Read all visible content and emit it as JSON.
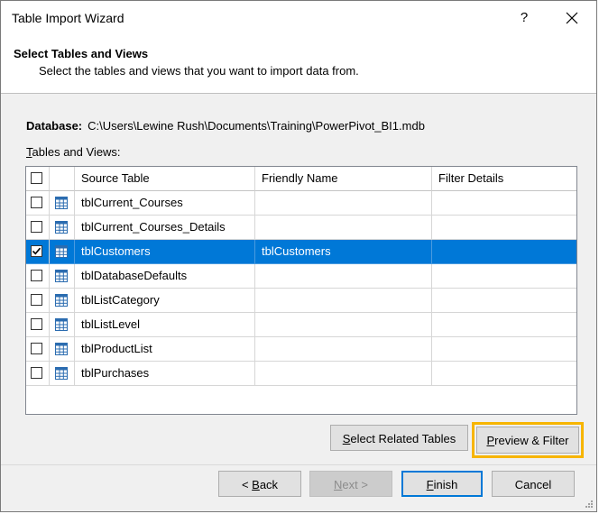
{
  "window": {
    "title": "Table Import Wizard",
    "help_label": "?",
    "header_title": "Select Tables and Views",
    "header_subtitle": "Select the tables and views that you want to import data from."
  },
  "database": {
    "label": "Database:",
    "path": "C:\\Users\\Lewine Rush\\Documents\\Training\\PowerPivot_BI1.mdb"
  },
  "tables_label": {
    "mnemonic": "T",
    "rest": "ables and Views:"
  },
  "grid": {
    "columns": [
      "Source Table",
      "Friendly Name",
      "Filter Details"
    ],
    "rows": [
      {
        "source": "tblCurrent_Courses",
        "friendly": "",
        "filter": "",
        "checked": false,
        "selected": false
      },
      {
        "source": "tblCurrent_Courses_Details",
        "friendly": "",
        "filter": "",
        "checked": false,
        "selected": false
      },
      {
        "source": "tblCustomers",
        "friendly": "tblCustomers",
        "filter": "",
        "checked": true,
        "selected": true
      },
      {
        "source": "tblDatabaseDefaults",
        "friendly": "",
        "filter": "",
        "checked": false,
        "selected": false
      },
      {
        "source": "tblListCategory",
        "friendly": "",
        "filter": "",
        "checked": false,
        "selected": false
      },
      {
        "source": "tblListLevel",
        "friendly": "",
        "filter": "",
        "checked": false,
        "selected": false
      },
      {
        "source": "tblProductList",
        "friendly": "",
        "filter": "",
        "checked": false,
        "selected": false
      },
      {
        "source": "tblPurchases",
        "friendly": "",
        "filter": "",
        "checked": false,
        "selected": false
      }
    ]
  },
  "buttons": {
    "select_related": {
      "mnemonic": "S",
      "rest": "elect Related Tables"
    },
    "preview_filter": {
      "mnemonic": "P",
      "rest": "review & Filter"
    },
    "back": {
      "prefix": "< ",
      "mnemonic": "B",
      "rest": "ack"
    },
    "next": {
      "mnemonic": "N",
      "rest": "ext >"
    },
    "finish": {
      "mnemonic": "F",
      "rest": "inish"
    },
    "cancel": {
      "label": "Cancel"
    }
  },
  "colors": {
    "selection": "#0078d7",
    "highlight": "#f7b500"
  },
  "icons": {
    "close": "close-icon",
    "table": "table-icon",
    "check": "checkmark-icon",
    "grip": "resize-grip-icon"
  }
}
